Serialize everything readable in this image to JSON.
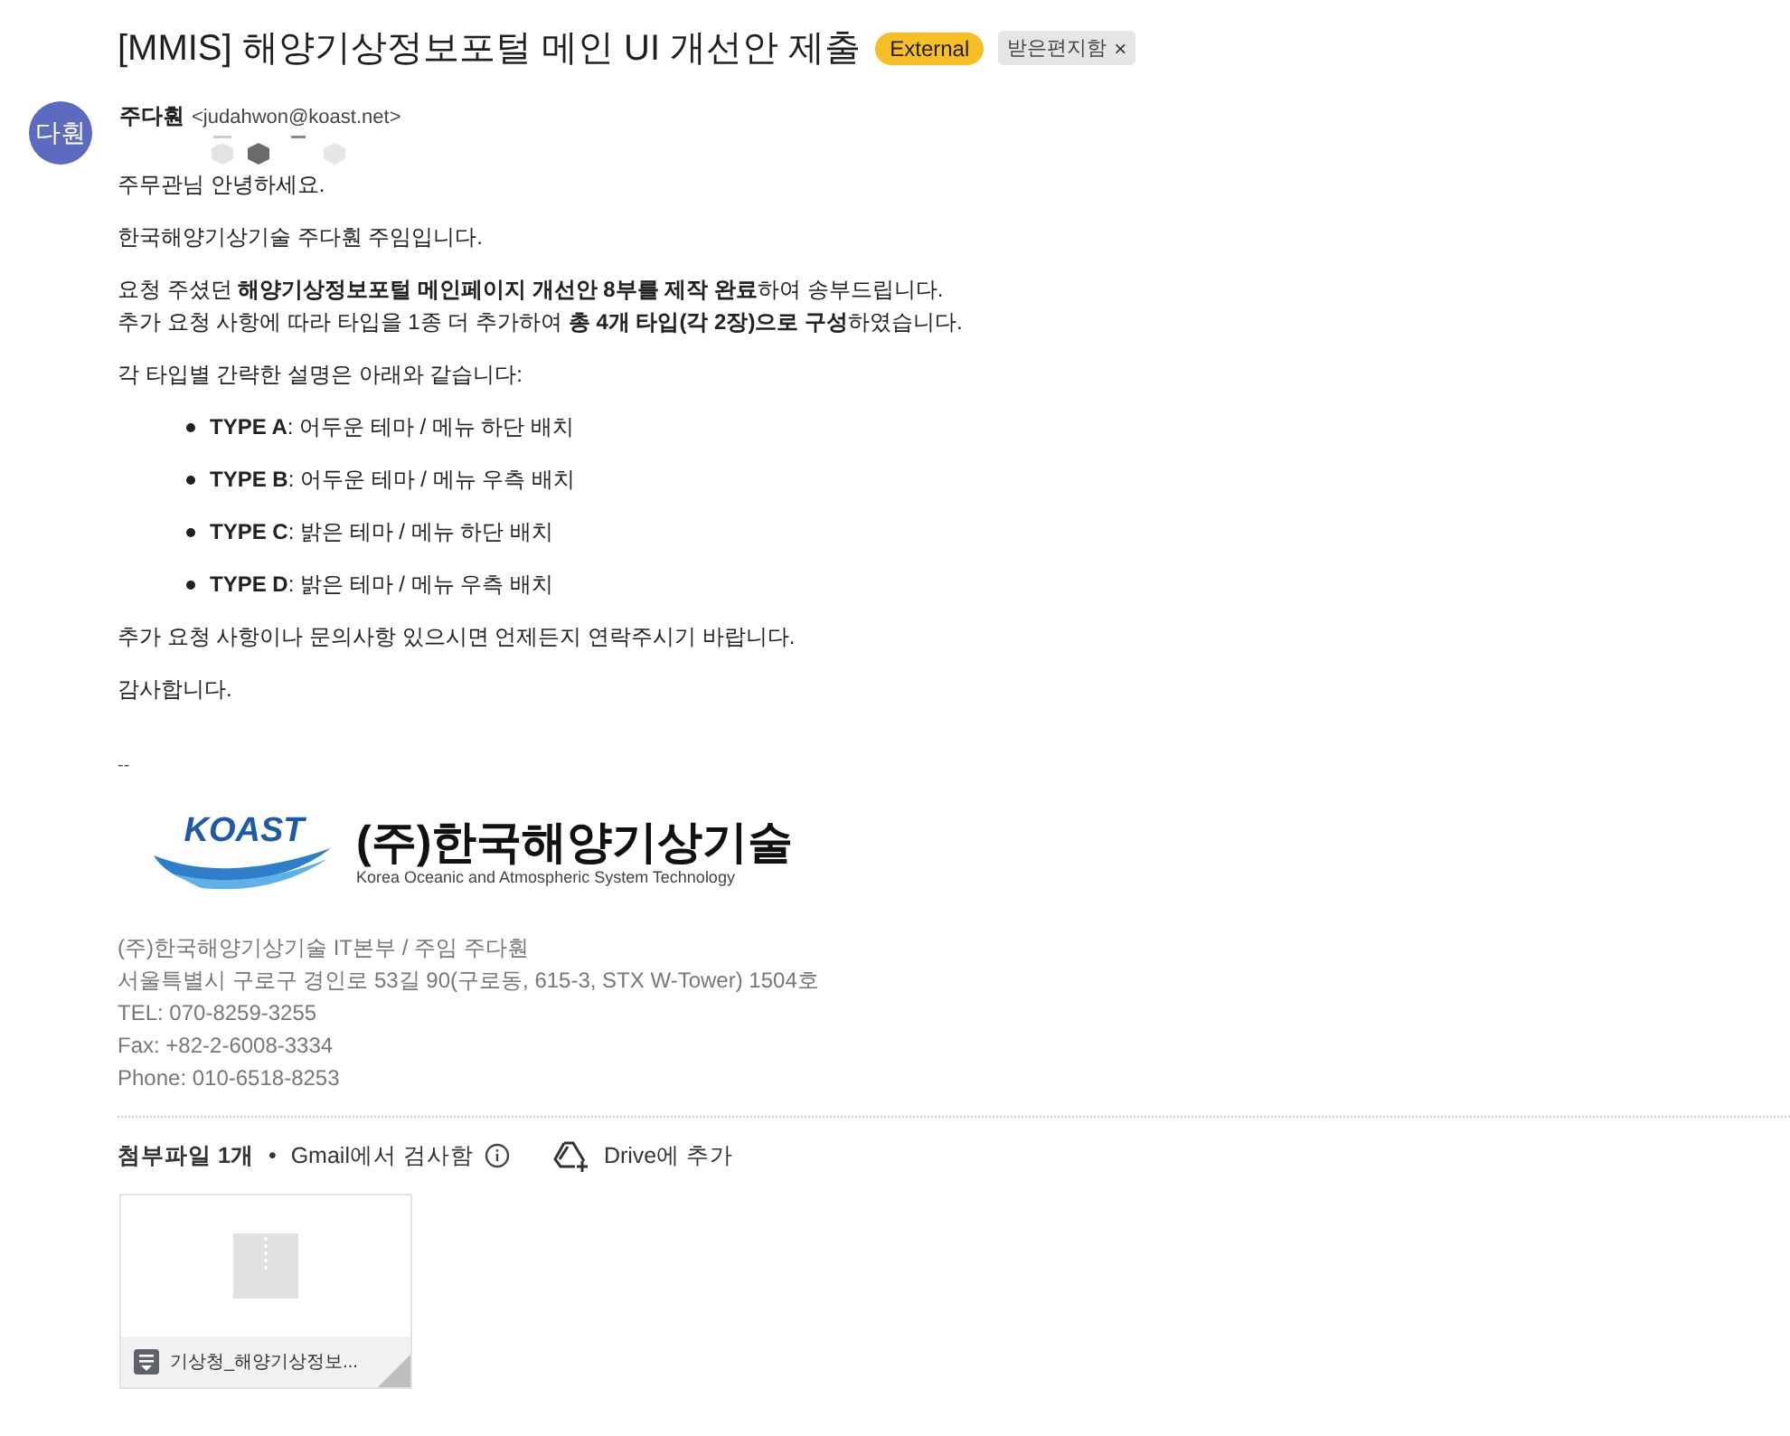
{
  "subject": "[MMIS] 해양기상정보포털 메인 UI 개선안 제출",
  "labels": [
    {
      "text": "External",
      "kind": "external"
    },
    {
      "text": "받은편지함",
      "kind": "inbox",
      "close": "×"
    }
  ],
  "sender": {
    "avatar": "다훤",
    "name": "주다훤",
    "email": "<judahwon@koast.net>"
  },
  "body": {
    "paragraphs_before": [
      "주무관님 안녕하세요.",
      "한국해양기상기술 주다훤 주임입니다.",
      "요청 주셨던 **해양기상정보포털 메인페이지 개선안 8부를 제작 완료**하여 송부드립니다.\n추가 요청 사항에 따라 타입을 1종 더 추가하여 **총 4개 타입(각 2장)으로 구성**하였습니다.",
      "각 타입별 간략한 설명은 아래와 같습니다:"
    ],
    "bullets": [
      "**TYPE A**: 어두운 테마 / 메뉴 하단 배치",
      "**TYPE B**: 어두운 테마 / 메뉴 우측 배치",
      "**TYPE C**: 밝은 테마 / 메뉴 하단 배치",
      "**TYPE D**: 밝은 테마 / 메뉴 우측 배치"
    ],
    "paragraphs_after": [
      "추가 요청 사항이나 문의사항 있으시면 언제든지 연락주시기 바랍니다.",
      "감사합니다."
    ]
  },
  "signature": {
    "separator": "--",
    "logo": {
      "wordmark": "KOAST",
      "company": "(주)한국해양기상기술",
      "english": "Korea Oceanic and Atmospheric System Technology"
    },
    "lines": [
      "(주)한국해양기상기술 IT본부 / 주임 주다훤",
      "서울특별시 구로구 경인로 53길 90(구로동, 615-3, STX W-Tower) 1504호",
      "TEL: 070-8259-3255",
      "Fax: +82-2-6008-3334",
      "Phone: 010-6518-8253"
    ]
  },
  "attachments": {
    "count": "첨부파일 1개",
    "dot": "•",
    "scan": "Gmail에서 검사함",
    "drive": "Drive에 추가",
    "files": [
      {
        "name": "기상청_해양기상정보..."
      }
    ]
  }
}
